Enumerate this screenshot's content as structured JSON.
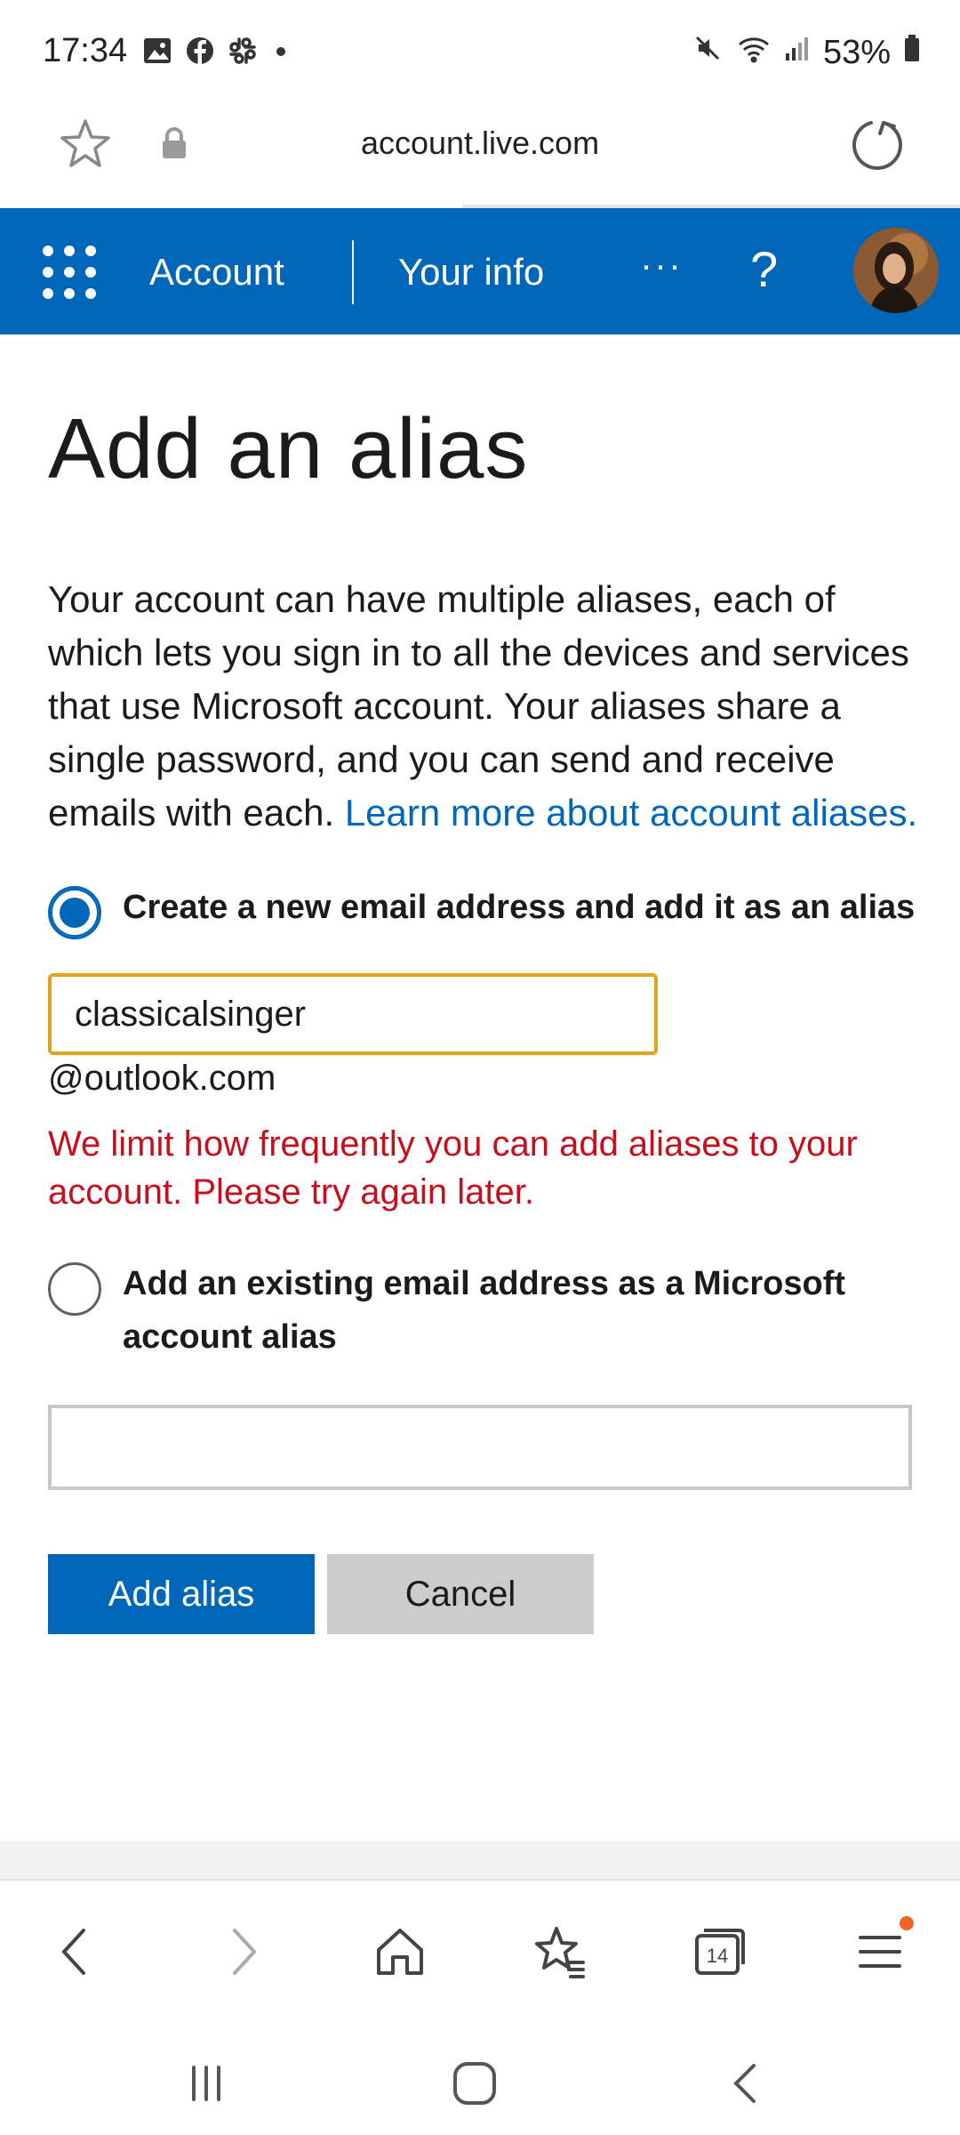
{
  "status_bar": {
    "time": "17:34",
    "battery": "53%",
    "notification_icons": [
      "image-icon",
      "facebook-icon",
      "slack-icon",
      "dot-icon"
    ],
    "system_icons": [
      "mute-icon",
      "wifi-icon",
      "signal-icon",
      "battery-icon"
    ]
  },
  "browser": {
    "url": "account.live.com",
    "tab_count": "14"
  },
  "header": {
    "account_label": "Account",
    "your_info_label": "Your info",
    "more_label": "···",
    "help_label": "?"
  },
  "page": {
    "title": "Add an alias",
    "description": "Your account can have multiple aliases, each of which lets you sign in to all the devices and services that use Microsoft account. Your aliases share a single password, and you can send and receive emails with each.",
    "learn_more_link": "Learn more about account aliases.",
    "option_new_label": "Create a new email address and add it as an alias",
    "option_new_selected": true,
    "alias_value": "classicalsinger",
    "domain": "@outlook.com",
    "error_message": "We limit how frequently you can add aliases to your account. Please try again later.",
    "option_existing_label": "Add an existing email address as a Microsoft account alias",
    "existing_value": "",
    "add_button": "Add alias",
    "cancel_button": "Cancel"
  },
  "colors": {
    "brand_blue": "#0067b8",
    "error_red": "#c50f1f",
    "focus_border": "#e1a21c"
  }
}
